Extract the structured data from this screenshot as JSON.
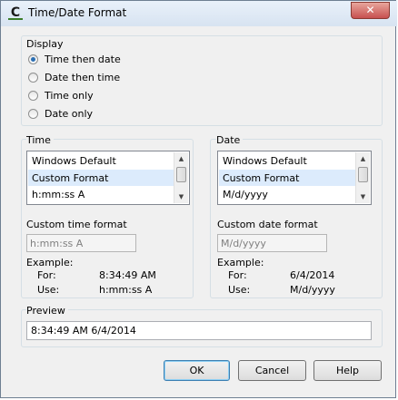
{
  "window": {
    "title": "Time/Date Format",
    "close_symbol": "✕",
    "app_icon_glyph": "C"
  },
  "display": {
    "label": "Display",
    "options": [
      "Time then date",
      "Date then time",
      "Time only",
      "Date only"
    ],
    "selected_index": 0
  },
  "time": {
    "label": "Time",
    "list_items": [
      "Windows Default",
      "Custom Format",
      "h:mm:ss A"
    ],
    "selected_index": 1,
    "custom_label": "Custom time format",
    "custom_value": "h:mm:ss A",
    "example_label": "Example:",
    "for_label": "For:",
    "for_value": "8:34:49 AM",
    "use_label": "Use:",
    "use_value": "h:mm:ss A"
  },
  "date": {
    "label": "Date",
    "list_items": [
      "Windows Default",
      "Custom Format",
      "M/d/yyyy"
    ],
    "selected_index": 1,
    "custom_label": "Custom date format",
    "custom_value": "M/d/yyyy",
    "example_label": "Example:",
    "for_label": "For:",
    "for_value": "6/4/2014",
    "use_label": "Use:",
    "use_value": "M/d/yyyy"
  },
  "preview": {
    "label": "Preview",
    "value": "8:34:49 AM 6/4/2014"
  },
  "buttons": {
    "ok": "OK",
    "cancel": "Cancel",
    "help": "Help"
  },
  "scroll_arrows": {
    "up": "▲",
    "down": "▼"
  }
}
